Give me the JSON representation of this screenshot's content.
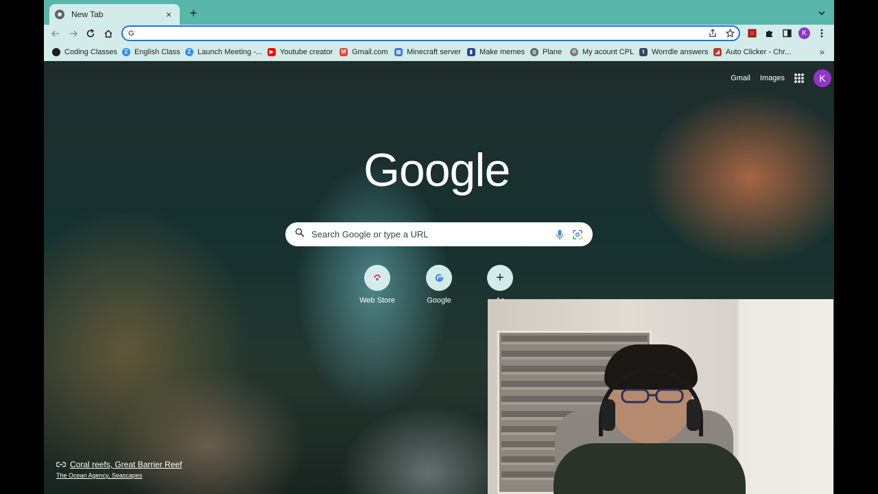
{
  "browser": {
    "tab": {
      "title": "New Tab",
      "close_glyph": "×"
    },
    "new_tab_glyph": "+",
    "omnibox": {
      "value": "",
      "placeholder": ""
    },
    "profile_initial": "K",
    "accent_color": "#1a73e8",
    "frame_color": "#58b6aa"
  },
  "bookmarks": {
    "items": [
      {
        "label": "Coding Classes",
        "icon": "github-icon",
        "color": "#1f1f1f",
        "glyph": "●"
      },
      {
        "label": "English Class",
        "icon": "zoom-icon",
        "color": "#2d8cff",
        "glyph": "Z"
      },
      {
        "label": "Launch Meeting -...",
        "icon": "zoom-icon",
        "color": "#2d8cff",
        "glyph": "Z"
      },
      {
        "label": "Youtube creator",
        "icon": "youtube-icon",
        "color": "#ff0000",
        "glyph": "▶"
      },
      {
        "label": "Gmail.com",
        "icon": "gmail-icon",
        "color": "#ea4335",
        "glyph": "M"
      },
      {
        "label": "Minecraft server",
        "icon": "minecraft-icon",
        "color": "#3b7bd8",
        "glyph": "▦"
      },
      {
        "label": "Make memes",
        "icon": "meme-icon",
        "color": "#234b8f",
        "glyph": "▮"
      },
      {
        "label": "Plane",
        "icon": "globe-icon",
        "color": "#5f6368",
        "glyph": "◍"
      },
      {
        "label": "My acount CPL",
        "icon": "gear-icon",
        "color": "#7a7a7a",
        "glyph": "✲"
      },
      {
        "label": "Worrdle answers",
        "icon": "tumblr-icon",
        "color": "#36465d",
        "glyph": "t"
      },
      {
        "label": "Auto Clicker - Chr...",
        "icon": "clicker-icon",
        "color": "#c0392b",
        "glyph": "◢"
      }
    ],
    "overflow_glyph": "»"
  },
  "newtab": {
    "links": {
      "gmail": "Gmail",
      "images": "Images"
    },
    "logo": "Google",
    "search": {
      "placeholder": "Search Google or type a URL"
    },
    "shortcuts": [
      {
        "label": "Web Store",
        "icon": "webstore-icon"
      },
      {
        "label": "Google",
        "icon": "google-icon"
      },
      {
        "label": "Ac",
        "icon": "add-shortcut-icon",
        "glyph": "+"
      }
    ],
    "attribution": {
      "title": "Coral reefs, Great Barrier Reef",
      "subtitle": "The Ocean Agency, Seascapes"
    }
  }
}
